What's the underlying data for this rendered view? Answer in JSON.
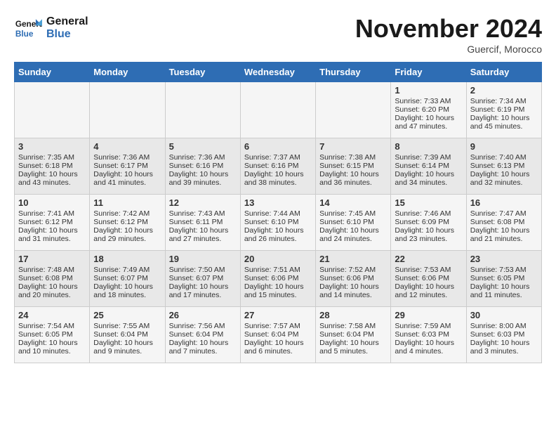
{
  "header": {
    "logo_line1": "General",
    "logo_line2": "Blue",
    "month": "November 2024",
    "location": "Guercif, Morocco"
  },
  "days_of_week": [
    "Sunday",
    "Monday",
    "Tuesday",
    "Wednesday",
    "Thursday",
    "Friday",
    "Saturday"
  ],
  "weeks": [
    [
      {
        "day": "",
        "info": ""
      },
      {
        "day": "",
        "info": ""
      },
      {
        "day": "",
        "info": ""
      },
      {
        "day": "",
        "info": ""
      },
      {
        "day": "",
        "info": ""
      },
      {
        "day": "1",
        "info": "Sunrise: 7:33 AM\nSunset: 6:20 PM\nDaylight: 10 hours and 47 minutes."
      },
      {
        "day": "2",
        "info": "Sunrise: 7:34 AM\nSunset: 6:19 PM\nDaylight: 10 hours and 45 minutes."
      }
    ],
    [
      {
        "day": "3",
        "info": "Sunrise: 7:35 AM\nSunset: 6:18 PM\nDaylight: 10 hours and 43 minutes."
      },
      {
        "day": "4",
        "info": "Sunrise: 7:36 AM\nSunset: 6:17 PM\nDaylight: 10 hours and 41 minutes."
      },
      {
        "day": "5",
        "info": "Sunrise: 7:36 AM\nSunset: 6:16 PM\nDaylight: 10 hours and 39 minutes."
      },
      {
        "day": "6",
        "info": "Sunrise: 7:37 AM\nSunset: 6:16 PM\nDaylight: 10 hours and 38 minutes."
      },
      {
        "day": "7",
        "info": "Sunrise: 7:38 AM\nSunset: 6:15 PM\nDaylight: 10 hours and 36 minutes."
      },
      {
        "day": "8",
        "info": "Sunrise: 7:39 AM\nSunset: 6:14 PM\nDaylight: 10 hours and 34 minutes."
      },
      {
        "day": "9",
        "info": "Sunrise: 7:40 AM\nSunset: 6:13 PM\nDaylight: 10 hours and 32 minutes."
      }
    ],
    [
      {
        "day": "10",
        "info": "Sunrise: 7:41 AM\nSunset: 6:12 PM\nDaylight: 10 hours and 31 minutes."
      },
      {
        "day": "11",
        "info": "Sunrise: 7:42 AM\nSunset: 6:12 PM\nDaylight: 10 hours and 29 minutes."
      },
      {
        "day": "12",
        "info": "Sunrise: 7:43 AM\nSunset: 6:11 PM\nDaylight: 10 hours and 27 minutes."
      },
      {
        "day": "13",
        "info": "Sunrise: 7:44 AM\nSunset: 6:10 PM\nDaylight: 10 hours and 26 minutes."
      },
      {
        "day": "14",
        "info": "Sunrise: 7:45 AM\nSunset: 6:10 PM\nDaylight: 10 hours and 24 minutes."
      },
      {
        "day": "15",
        "info": "Sunrise: 7:46 AM\nSunset: 6:09 PM\nDaylight: 10 hours and 23 minutes."
      },
      {
        "day": "16",
        "info": "Sunrise: 7:47 AM\nSunset: 6:08 PM\nDaylight: 10 hours and 21 minutes."
      }
    ],
    [
      {
        "day": "17",
        "info": "Sunrise: 7:48 AM\nSunset: 6:08 PM\nDaylight: 10 hours and 20 minutes."
      },
      {
        "day": "18",
        "info": "Sunrise: 7:49 AM\nSunset: 6:07 PM\nDaylight: 10 hours and 18 minutes."
      },
      {
        "day": "19",
        "info": "Sunrise: 7:50 AM\nSunset: 6:07 PM\nDaylight: 10 hours and 17 minutes."
      },
      {
        "day": "20",
        "info": "Sunrise: 7:51 AM\nSunset: 6:06 PM\nDaylight: 10 hours and 15 minutes."
      },
      {
        "day": "21",
        "info": "Sunrise: 7:52 AM\nSunset: 6:06 PM\nDaylight: 10 hours and 14 minutes."
      },
      {
        "day": "22",
        "info": "Sunrise: 7:53 AM\nSunset: 6:06 PM\nDaylight: 10 hours and 12 minutes."
      },
      {
        "day": "23",
        "info": "Sunrise: 7:53 AM\nSunset: 6:05 PM\nDaylight: 10 hours and 11 minutes."
      }
    ],
    [
      {
        "day": "24",
        "info": "Sunrise: 7:54 AM\nSunset: 6:05 PM\nDaylight: 10 hours and 10 minutes."
      },
      {
        "day": "25",
        "info": "Sunrise: 7:55 AM\nSunset: 6:04 PM\nDaylight: 10 hours and 9 minutes."
      },
      {
        "day": "26",
        "info": "Sunrise: 7:56 AM\nSunset: 6:04 PM\nDaylight: 10 hours and 7 minutes."
      },
      {
        "day": "27",
        "info": "Sunrise: 7:57 AM\nSunset: 6:04 PM\nDaylight: 10 hours and 6 minutes."
      },
      {
        "day": "28",
        "info": "Sunrise: 7:58 AM\nSunset: 6:04 PM\nDaylight: 10 hours and 5 minutes."
      },
      {
        "day": "29",
        "info": "Sunrise: 7:59 AM\nSunset: 6:03 PM\nDaylight: 10 hours and 4 minutes."
      },
      {
        "day": "30",
        "info": "Sunrise: 8:00 AM\nSunset: 6:03 PM\nDaylight: 10 hours and 3 minutes."
      }
    ]
  ]
}
